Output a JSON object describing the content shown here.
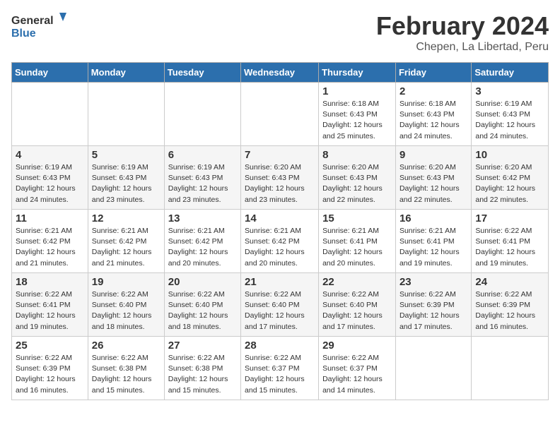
{
  "header": {
    "logo_general": "General",
    "logo_blue": "Blue",
    "month_title": "February 2024",
    "location": "Chepen, La Libertad, Peru"
  },
  "columns": [
    "Sunday",
    "Monday",
    "Tuesday",
    "Wednesday",
    "Thursday",
    "Friday",
    "Saturday"
  ],
  "weeks": [
    {
      "days": [
        {
          "number": "",
          "sunrise": "",
          "sunset": "",
          "daylight": "",
          "empty": true
        },
        {
          "number": "",
          "sunrise": "",
          "sunset": "",
          "daylight": "",
          "empty": true
        },
        {
          "number": "",
          "sunrise": "",
          "sunset": "",
          "daylight": "",
          "empty": true
        },
        {
          "number": "",
          "sunrise": "",
          "sunset": "",
          "daylight": "",
          "empty": true
        },
        {
          "number": "1",
          "sunrise": "Sunrise: 6:18 AM",
          "sunset": "Sunset: 6:43 PM",
          "daylight": "Daylight: 12 hours and 25 minutes.",
          "empty": false
        },
        {
          "number": "2",
          "sunrise": "Sunrise: 6:18 AM",
          "sunset": "Sunset: 6:43 PM",
          "daylight": "Daylight: 12 hours and 24 minutes.",
          "empty": false
        },
        {
          "number": "3",
          "sunrise": "Sunrise: 6:19 AM",
          "sunset": "Sunset: 6:43 PM",
          "daylight": "Daylight: 12 hours and 24 minutes.",
          "empty": false
        }
      ]
    },
    {
      "days": [
        {
          "number": "4",
          "sunrise": "Sunrise: 6:19 AM",
          "sunset": "Sunset: 6:43 PM",
          "daylight": "Daylight: 12 hours and 24 minutes.",
          "empty": false
        },
        {
          "number": "5",
          "sunrise": "Sunrise: 6:19 AM",
          "sunset": "Sunset: 6:43 PM",
          "daylight": "Daylight: 12 hours and 23 minutes.",
          "empty": false
        },
        {
          "number": "6",
          "sunrise": "Sunrise: 6:19 AM",
          "sunset": "Sunset: 6:43 PM",
          "daylight": "Daylight: 12 hours and 23 minutes.",
          "empty": false
        },
        {
          "number": "7",
          "sunrise": "Sunrise: 6:20 AM",
          "sunset": "Sunset: 6:43 PM",
          "daylight": "Daylight: 12 hours and 23 minutes.",
          "empty": false
        },
        {
          "number": "8",
          "sunrise": "Sunrise: 6:20 AM",
          "sunset": "Sunset: 6:43 PM",
          "daylight": "Daylight: 12 hours and 22 minutes.",
          "empty": false
        },
        {
          "number": "9",
          "sunrise": "Sunrise: 6:20 AM",
          "sunset": "Sunset: 6:43 PM",
          "daylight": "Daylight: 12 hours and 22 minutes.",
          "empty": false
        },
        {
          "number": "10",
          "sunrise": "Sunrise: 6:20 AM",
          "sunset": "Sunset: 6:42 PM",
          "daylight": "Daylight: 12 hours and 22 minutes.",
          "empty": false
        }
      ]
    },
    {
      "days": [
        {
          "number": "11",
          "sunrise": "Sunrise: 6:21 AM",
          "sunset": "Sunset: 6:42 PM",
          "daylight": "Daylight: 12 hours and 21 minutes.",
          "empty": false
        },
        {
          "number": "12",
          "sunrise": "Sunrise: 6:21 AM",
          "sunset": "Sunset: 6:42 PM",
          "daylight": "Daylight: 12 hours and 21 minutes.",
          "empty": false
        },
        {
          "number": "13",
          "sunrise": "Sunrise: 6:21 AM",
          "sunset": "Sunset: 6:42 PM",
          "daylight": "Daylight: 12 hours and 20 minutes.",
          "empty": false
        },
        {
          "number": "14",
          "sunrise": "Sunrise: 6:21 AM",
          "sunset": "Sunset: 6:42 PM",
          "daylight": "Daylight: 12 hours and 20 minutes.",
          "empty": false
        },
        {
          "number": "15",
          "sunrise": "Sunrise: 6:21 AM",
          "sunset": "Sunset: 6:41 PM",
          "daylight": "Daylight: 12 hours and 20 minutes.",
          "empty": false
        },
        {
          "number": "16",
          "sunrise": "Sunrise: 6:21 AM",
          "sunset": "Sunset: 6:41 PM",
          "daylight": "Daylight: 12 hours and 19 minutes.",
          "empty": false
        },
        {
          "number": "17",
          "sunrise": "Sunrise: 6:22 AM",
          "sunset": "Sunset: 6:41 PM",
          "daylight": "Daylight: 12 hours and 19 minutes.",
          "empty": false
        }
      ]
    },
    {
      "days": [
        {
          "number": "18",
          "sunrise": "Sunrise: 6:22 AM",
          "sunset": "Sunset: 6:41 PM",
          "daylight": "Daylight: 12 hours and 19 minutes.",
          "empty": false
        },
        {
          "number": "19",
          "sunrise": "Sunrise: 6:22 AM",
          "sunset": "Sunset: 6:40 PM",
          "daylight": "Daylight: 12 hours and 18 minutes.",
          "empty": false
        },
        {
          "number": "20",
          "sunrise": "Sunrise: 6:22 AM",
          "sunset": "Sunset: 6:40 PM",
          "daylight": "Daylight: 12 hours and 18 minutes.",
          "empty": false
        },
        {
          "number": "21",
          "sunrise": "Sunrise: 6:22 AM",
          "sunset": "Sunset: 6:40 PM",
          "daylight": "Daylight: 12 hours and 17 minutes.",
          "empty": false
        },
        {
          "number": "22",
          "sunrise": "Sunrise: 6:22 AM",
          "sunset": "Sunset: 6:40 PM",
          "daylight": "Daylight: 12 hours and 17 minutes.",
          "empty": false
        },
        {
          "number": "23",
          "sunrise": "Sunrise: 6:22 AM",
          "sunset": "Sunset: 6:39 PM",
          "daylight": "Daylight: 12 hours and 17 minutes.",
          "empty": false
        },
        {
          "number": "24",
          "sunrise": "Sunrise: 6:22 AM",
          "sunset": "Sunset: 6:39 PM",
          "daylight": "Daylight: 12 hours and 16 minutes.",
          "empty": false
        }
      ]
    },
    {
      "days": [
        {
          "number": "25",
          "sunrise": "Sunrise: 6:22 AM",
          "sunset": "Sunset: 6:39 PM",
          "daylight": "Daylight: 12 hours and 16 minutes.",
          "empty": false
        },
        {
          "number": "26",
          "sunrise": "Sunrise: 6:22 AM",
          "sunset": "Sunset: 6:38 PM",
          "daylight": "Daylight: 12 hours and 15 minutes.",
          "empty": false
        },
        {
          "number": "27",
          "sunrise": "Sunrise: 6:22 AM",
          "sunset": "Sunset: 6:38 PM",
          "daylight": "Daylight: 12 hours and 15 minutes.",
          "empty": false
        },
        {
          "number": "28",
          "sunrise": "Sunrise: 6:22 AM",
          "sunset": "Sunset: 6:37 PM",
          "daylight": "Daylight: 12 hours and 15 minutes.",
          "empty": false
        },
        {
          "number": "29",
          "sunrise": "Sunrise: 6:22 AM",
          "sunset": "Sunset: 6:37 PM",
          "daylight": "Daylight: 12 hours and 14 minutes.",
          "empty": false
        },
        {
          "number": "",
          "sunrise": "",
          "sunset": "",
          "daylight": "",
          "empty": true
        },
        {
          "number": "",
          "sunrise": "",
          "sunset": "",
          "daylight": "",
          "empty": true
        }
      ]
    }
  ]
}
